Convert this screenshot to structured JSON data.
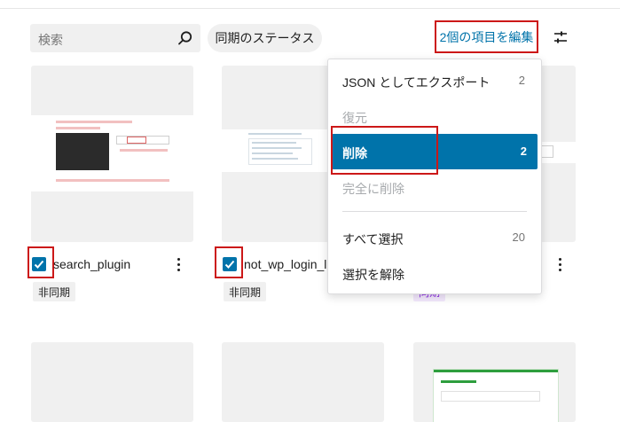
{
  "toolbar": {
    "search_placeholder": "検索",
    "status_filter_label": "同期のステータス",
    "bulk_edit_label": "2個の項目を編集"
  },
  "cards": [
    {
      "title": "search_plugin",
      "badge": "非同期",
      "checked": true
    },
    {
      "title": "not_wp_login_lir",
      "badge": "非同期",
      "checked": true
    },
    {
      "title": "",
      "badge": "同期",
      "checked": false
    }
  ],
  "bulk_menu": {
    "items": [
      {
        "label": "JSON としてエクスポート",
        "count": "2",
        "disabled": false
      },
      {
        "label": "復元",
        "count": "",
        "disabled": true
      },
      {
        "label": "削除",
        "count": "2",
        "disabled": false,
        "active": true
      },
      {
        "label": "完全に削除",
        "count": "",
        "disabled": true
      },
      {
        "label": "すべて選択",
        "count": "20",
        "disabled": false
      },
      {
        "label": "選択を解除",
        "count": "",
        "disabled": false
      }
    ]
  },
  "colors": {
    "accent": "#0073aa",
    "highlight_border": "#cc1818",
    "surface": "#f0f0f0"
  },
  "icons": {
    "search": "search-icon",
    "settings": "sliders-icon",
    "more": "kebab-icon",
    "check": "checkmark-icon"
  }
}
